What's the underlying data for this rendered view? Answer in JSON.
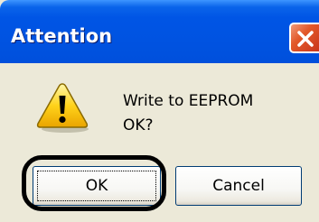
{
  "dialog": {
    "title": "Attention",
    "message_line1": "Write to EEPROM",
    "message_line2": "OK?",
    "icon": "warning-icon"
  },
  "buttons": {
    "ok_label": "OK",
    "cancel_label": "Cancel"
  },
  "close_icon": "close-icon",
  "colors": {
    "titlebar": "#0055e5",
    "close": "#e2582a",
    "background": "#ece9d8"
  }
}
